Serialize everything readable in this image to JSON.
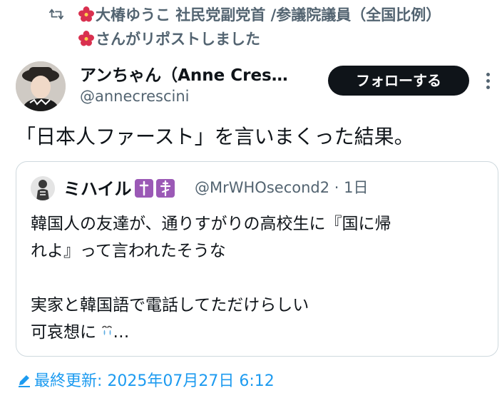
{
  "repost": {
    "line1": "大椿ゆうこ 社民党副党首 /参議院議員（全国比例）",
    "line2": "さんがリポストしました",
    "icon": "repost-icon"
  },
  "author": {
    "display_name": "アンちゃん（Anne Cres…",
    "handle": "@annecrescini"
  },
  "follow_button": {
    "label": "フォローする"
  },
  "tweet": {
    "text": "「日本人ファースト」を言いまくった結果。"
  },
  "quote": {
    "name": "ミハイル",
    "meta": "@MrWHOsecond2 · 1日",
    "lines": [
      "韓国人の友達が、通りすがりの高校生に『国に帰",
      "れよ』って言われたそうな",
      "実家と韓国語で電話してただけらしい",
      "可哀想に"
    ],
    "ellipsis": "…"
  },
  "footer": {
    "updated_text": "最終更新: 2025年07月27日 6:12"
  },
  "colors": {
    "text": "#0f1419",
    "muted": "#536471",
    "accent": "#1d9bf0",
    "border": "#cfd9de",
    "follow_bg": "#0f1419",
    "hibiscus": "#d9304f",
    "badge": "#9b59b6"
  }
}
